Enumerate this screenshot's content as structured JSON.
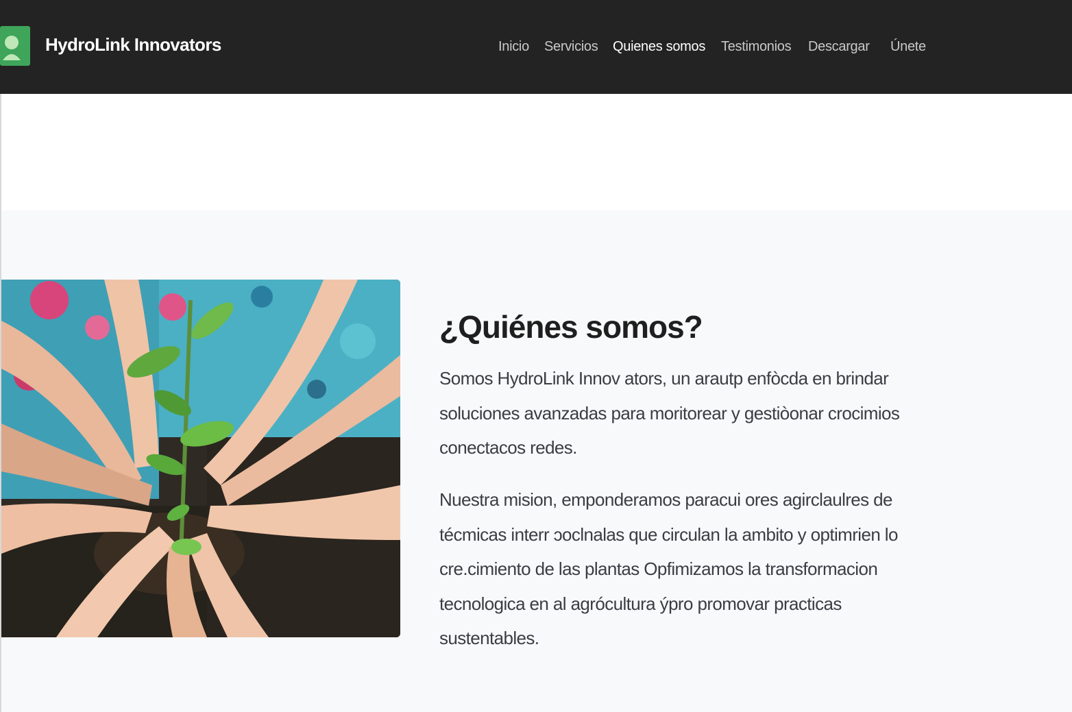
{
  "header": {
    "brand": "HydroLink Innovators",
    "logo_icon": "person-icon",
    "nav": [
      {
        "label": "Inicio",
        "active": false
      },
      {
        "label": "Servicios",
        "active": false
      },
      {
        "label": "Quienes somos",
        "active": true
      },
      {
        "label": "Testimonios",
        "active": false
      },
      {
        "label": "Descargar",
        "active": false
      },
      {
        "label": "Únete",
        "active": false
      }
    ]
  },
  "about": {
    "title": "¿Quiénes somos?",
    "paragraph_1": "Somos HydroLink Innov ators, un arautp enfòcda en brindar soluciones avanzadas para moritorear y gestiòonar crocimios conectacos redes.",
    "paragraph_2": "Nuestra mision, emponderamos paracui ores agirclaulres de técmicas interr ɔoclnalas que circulan la ambito y optimrien lo cre.cimiento de las plantas Opfimizamos la transformacion tecnologica en al agrócultura ýpro promovar practicas sustentables.",
    "image": "hands-holding-plant-photo"
  },
  "colors": {
    "header_bg": "#232323",
    "logo_green": "#3ea55a",
    "section_bg": "#f8f9fb",
    "title_text": "#1f1f1f",
    "body_text": "#3b3d42"
  }
}
